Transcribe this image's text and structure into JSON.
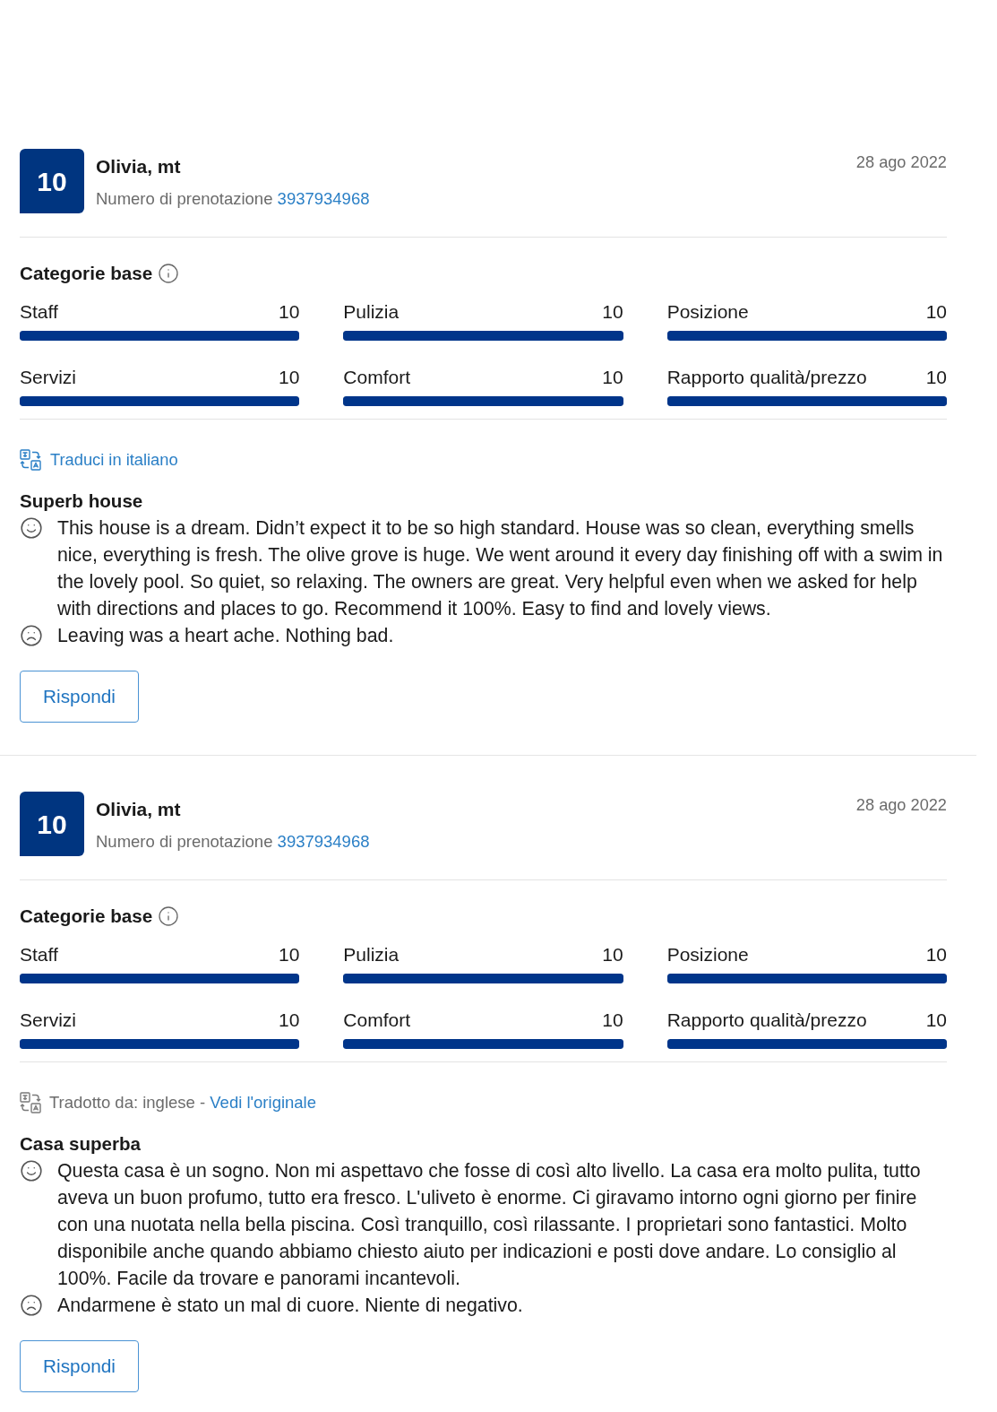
{
  "reviews": [
    {
      "score": "10",
      "name": "Olivia, mt",
      "booking_label": "Numero di prenotazione",
      "booking_number": "3937934968",
      "date": "28 ago 2022",
      "categories_title": "Categorie base",
      "categories": [
        {
          "name": "Staff",
          "score": "10",
          "level": 1
        },
        {
          "name": "Pulizia",
          "score": "10",
          "level": 1
        },
        {
          "name": "Posizione",
          "score": "10",
          "level": 1
        },
        {
          "name": "Servizi",
          "score": "10",
          "level": 1
        },
        {
          "name": "Comfort",
          "score": "10",
          "level": 1
        },
        {
          "name": "Rapporto qualità/prezzo",
          "score": "10",
          "level": 1
        }
      ],
      "translation": {
        "kind": "offer",
        "link": "Traduci in italiano"
      },
      "title": "Superb house",
      "positive": "This house is a dream. Didn’t expect it to be so high standard. House was so clean, everything smells nice, everything is fresh. The olive grove is huge. We went around it every day finishing off with a swim in the lovely pool. So quiet, so relaxing. The owners are great. Very helpful even when we asked for help with directions and places to go. Recommend it 100%. Easy to find and lovely views.",
      "negative": "Leaving was a heart ache. Nothing bad.",
      "reply_button": "Rispondi"
    },
    {
      "score": "10",
      "name": "Olivia, mt",
      "booking_label": "Numero di prenotazione",
      "booking_number": "3937934968",
      "date": "28 ago 2022",
      "categories_title": "Categorie base",
      "categories": [
        {
          "name": "Staff",
          "score": "10",
          "level": 1
        },
        {
          "name": "Pulizia",
          "score": "10",
          "level": 1
        },
        {
          "name": "Posizione",
          "score": "10",
          "level": 1
        },
        {
          "name": "Servizi",
          "score": "10",
          "level": 1
        },
        {
          "name": "Comfort",
          "score": "10",
          "level": 1
        },
        {
          "name": "Rapporto qualità/prezzo",
          "score": "10",
          "level": 1
        }
      ],
      "translation": {
        "kind": "translated",
        "note": "Tradotto da: inglese -",
        "link": "Vedi l'originale"
      },
      "title": "Casa superba",
      "positive": "Questa casa è un sogno. Non mi aspettavo che fosse di così alto livello. La casa era molto pulita, tutto aveva un buon profumo, tutto era fresco. L'uliveto è enorme. Ci giravamo intorno ogni giorno per finire con una nuotata nella bella piscina. Così tranquillo, così rilassante. I proprietari sono fantastici. Molto disponibile anche quando abbiamo chiesto aiuto per indicazioni e posti dove andare. Lo consiglio al 100%. Facile da trovare e panorami incantevoli.",
      "negative": "Andarmene è stato un mal di cuore. Niente di negativo.",
      "reply_button": "Rispondi"
    }
  ]
}
